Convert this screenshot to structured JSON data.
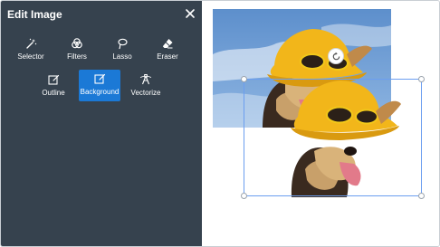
{
  "panel": {
    "title": "Edit Image",
    "tools_row1": [
      {
        "label": "Selector",
        "icon": "magic-wand-icon"
      },
      {
        "label": "Filters",
        "icon": "filters-icon"
      },
      {
        "label": "Lasso",
        "icon": "lasso-icon"
      },
      {
        "label": "Eraser",
        "icon": "eraser-icon"
      }
    ],
    "tools_row2": [
      {
        "label": "Outline",
        "icon": "outline-icon"
      },
      {
        "label": "Background",
        "icon": "background-icon",
        "active": true
      },
      {
        "label": "Vectorize",
        "icon": "vectorize-icon"
      }
    ]
  },
  "colors": {
    "panel_bg": "#36424e",
    "accent": "#1b79d6",
    "selection": "#6b9ef0"
  }
}
